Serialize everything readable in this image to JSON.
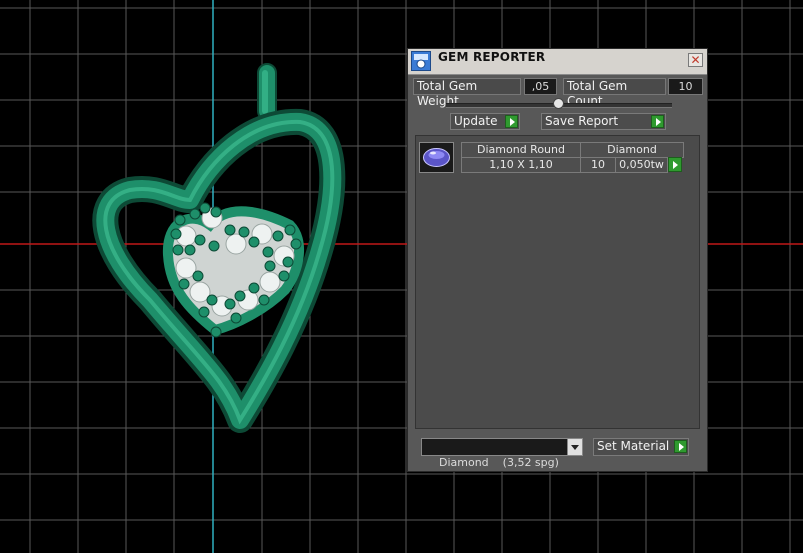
{
  "panel": {
    "title": "GEM REPORTER",
    "close_glyph": "✕",
    "total_gem_weight_label": "Total Gem Weight",
    "total_gem_weight_value": ",05",
    "total_gem_count_label": "Total Gem Count",
    "total_gem_count_value": "10",
    "update_label": "Update",
    "save_report_label": "Save Report",
    "gems": [
      {
        "shape": "Diamond Round",
        "material": "Diamond",
        "size": "1,10 X 1,10",
        "count": "10",
        "weight": "0,050tw"
      }
    ],
    "material_select_value": "Diamond    (3,52 spg)",
    "set_material_label": "Set Material"
  },
  "colors": {
    "viewport_bg": "#000000",
    "grid": "#5a5a5a",
    "axis_cyan": "#2fb0c0",
    "axis_red": "#c01818",
    "pendant_green": "#1e8f6a",
    "panel_bg": "#585858",
    "accent_green": "#2f9a2f"
  },
  "icons": {
    "app": "gem-reporter-icon",
    "close": "close-icon",
    "arrow": "play-arrow-icon",
    "dropdown": "chevron-down-icon",
    "gem": "round-diamond-icon"
  }
}
